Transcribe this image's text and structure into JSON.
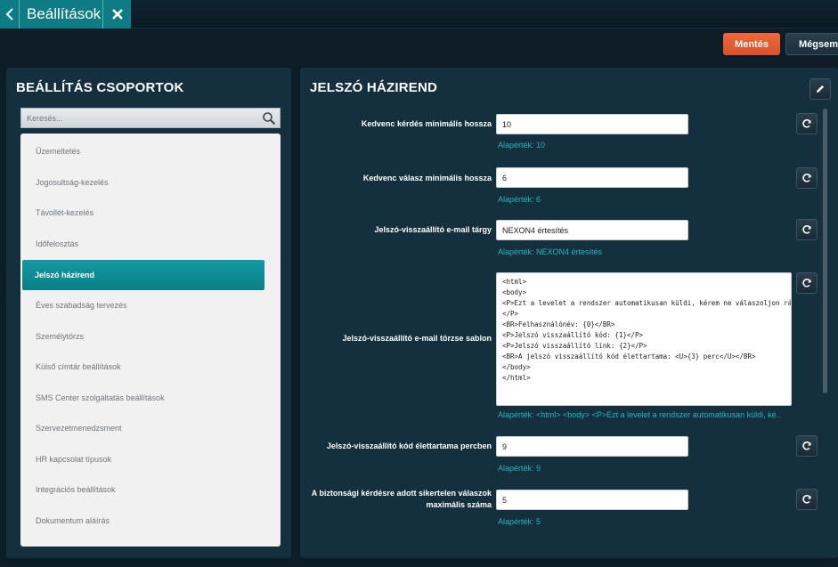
{
  "window": {
    "title": "Beállítások",
    "back_icon": "chevron-left-icon",
    "close_icon": "close-icon"
  },
  "actions": {
    "save_label": "Mentés",
    "cancel_label": "Mégsem"
  },
  "colors": {
    "accent": "#0e7b85",
    "save": "#e85f33",
    "panel": "#14303f",
    "default_text": "#27b3bd"
  },
  "groups": {
    "title": "BEÁLLÍTÁS CSOPORTOK",
    "search_placeholder": "Keresés...",
    "items": [
      {
        "label": "Üzemeltetés"
      },
      {
        "label": "Jogosultság-kezelés"
      },
      {
        "label": "Távollét-kezelés"
      },
      {
        "label": "Időfelosztás"
      },
      {
        "label": "Jelszó házirend",
        "selected": true
      },
      {
        "label": "Éves szabadság tervezés"
      },
      {
        "label": "Személytörzs"
      },
      {
        "label": "Külső címtár beállítások"
      },
      {
        "label": "SMS Center szolgáltatás beállítások"
      },
      {
        "label": "Szervezetmenedzsment"
      },
      {
        "label": "HR kapcsolat típusok"
      },
      {
        "label": "Integrációs beállítások"
      },
      {
        "label": "Dokumentum aláírás"
      }
    ]
  },
  "settings": {
    "title": "JELSZÓ HÁZIREND",
    "fields": [
      {
        "label": "Kedvenc kérdés minimális hossza",
        "value": "10",
        "default": "Alapérték: 10"
      },
      {
        "label": "Kedvenc válasz minimális hossza",
        "value": "6",
        "default": "Alapérték: 6"
      },
      {
        "label": "Jelszó-visszaállító e-mail tárgy",
        "value": "NEXON4 értesítés",
        "default": "Alapérték: NEXON4 értesítés"
      },
      {
        "label": "Jelszó-visszaállító e-mail törzse sablon",
        "value": "<html>\n<body>\n<P>Ezt a levelet a rendszer automatikusan küldi, kérem ne válaszoljon rá!\n</P>\n<BR>Felhasználónév: {0}</BR>\n<P>Jelszó visszaállító kód: {1}</P>\n<P>Jelszó visszaállító link: {2}</P>\n<BR>A jelszó visszaállító kód élettartama: <U>{3} perc</U></BR>\n</body>\n</html>",
        "default": "Alapérték: <html> <body> <P>Ezt a levelet a rendszer automatikusan küldi, ké.."
      },
      {
        "label": "Jelszó-visszaállító kód élettartama percben",
        "value": "9",
        "default": "Alapérték: 9"
      },
      {
        "label_line1": "A biztonsági kérdésre adott sikertelen válaszok",
        "label_line2": "maximális száma",
        "value": "5",
        "default": "Alapérték: 5"
      }
    ]
  }
}
